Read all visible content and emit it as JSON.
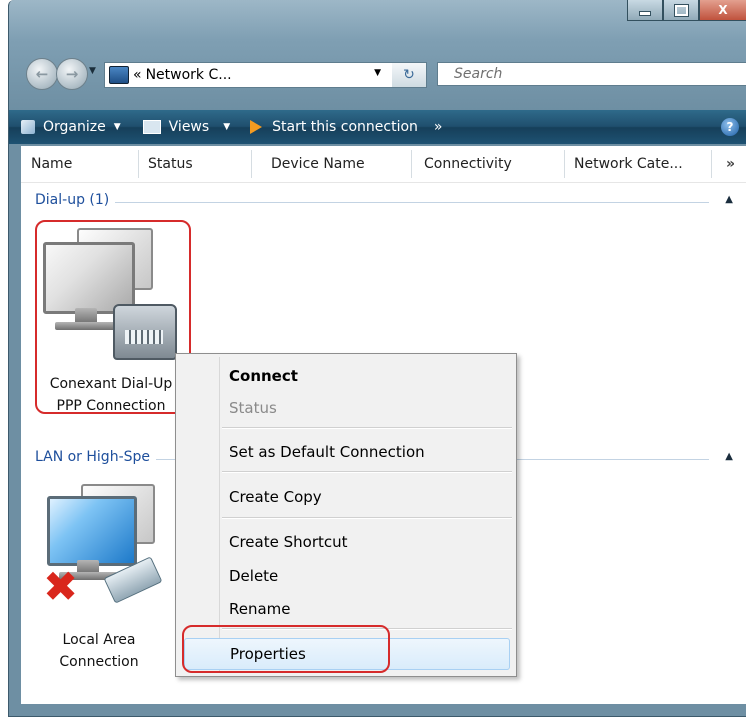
{
  "window": {
    "controls": {
      "minimize_icon": "minimize-icon",
      "maximize_icon": "maximize-icon",
      "close_label": "X"
    }
  },
  "address_bar": {
    "back_icon": "back-arrow-icon",
    "forward_icon": "forward-arrow-icon",
    "breadcrumb_prefix": "«",
    "path_text": "Network C...",
    "refresh_icon": "refresh-icon",
    "search_placeholder": "Search"
  },
  "toolbar": {
    "organize_label": "Organize",
    "views_label": "Views",
    "start_connection_label": "Start this connection",
    "more_label": "»",
    "help_label": "?"
  },
  "columns": {
    "headers": [
      "Name",
      "Status",
      "Device Name",
      "Connectivity",
      "Network Cate..."
    ],
    "more_label": "»"
  },
  "groups": {
    "dialup": {
      "label": "Dial-up (1)",
      "items": [
        {
          "line1": "Conexant Dial-Up",
          "line2": "PPP Connection"
        }
      ]
    },
    "lan": {
      "label": "LAN or High-Spe",
      "items": [
        {
          "line1": "Local Area",
          "line2": "Connection"
        }
      ]
    }
  },
  "context_menu": {
    "items": [
      {
        "label": "Connect",
        "style": "bold"
      },
      {
        "label": "Status",
        "style": "disabled"
      },
      {
        "label": "Set as Default Connection",
        "style": "normal"
      },
      {
        "label": "Create Copy",
        "style": "normal"
      },
      {
        "label": "Create Shortcut",
        "style": "normal"
      },
      {
        "label": "Delete",
        "style": "normal"
      },
      {
        "label": "Rename",
        "style": "normal"
      },
      {
        "label": "Properties",
        "style": "selected"
      }
    ]
  },
  "colors": {
    "highlight_outline": "#d62b2b",
    "group_header_text": "#1e4f9c",
    "toolbar_bg": "#1f4f6e"
  }
}
